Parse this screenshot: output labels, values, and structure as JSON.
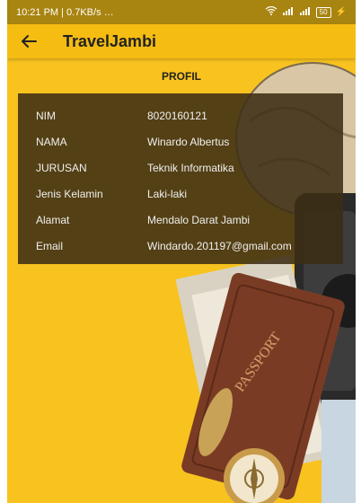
{
  "status_bar": {
    "time_speed": "10:21 PM | 0.7KB/s ",
    "extra": "…",
    "battery": "50"
  },
  "app_bar": {
    "title": "TravelJambi"
  },
  "profile": {
    "title": "PROFIL",
    "rows": [
      {
        "label": "NIM",
        "value": "8020160121"
      },
      {
        "label": "NAMA",
        "value": "Winardo Albertus"
      },
      {
        "label": "JURUSAN",
        "value": "Teknik Informatika"
      },
      {
        "label": "Jenis Kelamin",
        "value": "Laki-laki"
      },
      {
        "label": "Alamat",
        "value": "Mendalo Darat Jambi"
      },
      {
        "label": "Email",
        "value": "Windardo.201197@gmail.com"
      }
    ]
  },
  "background": {
    "passport_text": "PASSPORT",
    "accent": "#f8c21f"
  }
}
